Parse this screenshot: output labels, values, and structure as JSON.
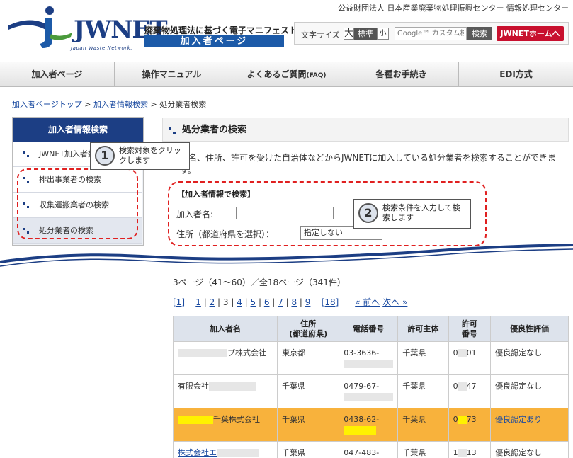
{
  "header": {
    "org_name": "公益財団法人 日本産業廃棄物処理振興センター 情報処理センター",
    "logo_text": "JWNET",
    "logo_sub": "Japan Waste Network.",
    "tagline": "廃棄物処理法に基づく電子マニフェスト",
    "section_badge": "加入者ページ",
    "font_size_label": "文字サイズ",
    "font_size_large": "大",
    "font_size_standard": "標準",
    "font_size_small": "小",
    "search_placeholder": "Google™ カスタム検索",
    "search_button": "検索",
    "home_button": "JWNETホームへ"
  },
  "nav": {
    "items": [
      "加入者ページ",
      "操作マニュアル",
      "よくあるご質問",
      "各種お手続き",
      "EDI方式"
    ],
    "faq_suffix": "(FAQ)"
  },
  "breadcrumb": {
    "top": "加入者ページトップ",
    "sep": " > ",
    "info_search": "加入者情報検索",
    "current": "処分業者検索"
  },
  "sidebar": {
    "title": "加入者情報検索",
    "items": [
      "JWNET加入者数",
      "排出事業者の検索",
      "収集運搬業者の検索",
      "処分業者の検索"
    ]
  },
  "main": {
    "title": "処分業者の検索",
    "description": "者名、住所、許可を受けた自治体などからJWNETに加入している処分業者を検索することができます。",
    "search_heading": "【加入者情報で検索】",
    "name_label": "加入者名:",
    "address_label": "住所（都道府県を選択）：",
    "address_select": "指定しない"
  },
  "callouts": {
    "one_num": "1",
    "one_text": "検索対象をクリックします",
    "two_num": "2",
    "two_text": "検索条件を入力して検索します"
  },
  "results": {
    "page_count": "3ページ（41～60）／全18ページ（341件）",
    "pager": {
      "first": "[1]",
      "pages": [
        "1",
        "2",
        "3",
        "4",
        "5",
        "6",
        "7",
        "8",
        "9"
      ],
      "last": "[18]",
      "prev": "« 前へ",
      "next": "次へ »"
    },
    "headers": [
      "加入者名",
      "住所\n(都道府県)",
      "電話番号",
      "許可主体",
      "許可\n番号",
      "優良性評価"
    ],
    "rows": [
      {
        "name": "プ株式会社",
        "pref": "東京都",
        "tel": "03-3636-",
        "auth": "千葉県",
        "lic_pre": "0",
        "lic_post": "01",
        "eval": "優良認定なし"
      },
      {
        "name": "有限会社",
        "pref": "千葉県",
        "tel": "0479-67-",
        "auth": "千葉県",
        "lic_pre": "0",
        "lic_post": "47",
        "eval": "優良認定なし"
      },
      {
        "name": "千葉株式会社",
        "pref": "千葉県",
        "tel": "0438-62-",
        "auth": "千葉県",
        "lic_pre": "0",
        "lic_post": "73",
        "eval": "優良認定あり"
      },
      {
        "name": "株式会社エ",
        "pref": "千葉県",
        "tel": "047-483-",
        "auth": "千葉県",
        "lic_pre": "1",
        "lic_post": "13",
        "eval": "優良認定なし"
      }
    ]
  },
  "colors": {
    "brand_blue": "#1c3e84",
    "highlight": "#f8b23c",
    "callout_red": "#e02020"
  }
}
